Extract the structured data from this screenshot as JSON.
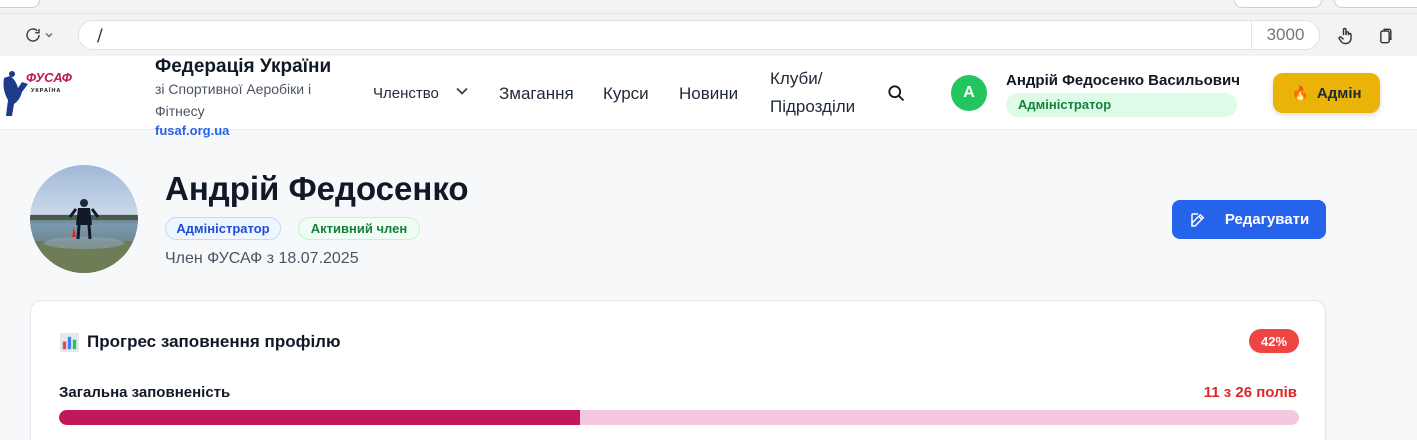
{
  "browser": {
    "url_path": "/",
    "port": "3000"
  },
  "header": {
    "logo_text": "ФУСАФ",
    "logo_sub": "УКРАЇНА",
    "brand_title": "Федерація України",
    "brand_subtitle": "зі Спортивної Аеробіки і Фітнесу",
    "brand_site": "fusaf.org.ua",
    "nav": {
      "membership": "Членство",
      "competitions": "Змагання",
      "courses": "Курси",
      "news": "Новини",
      "clubs_line1": "Клуби/",
      "clubs_line2": "Підрозділи"
    },
    "user": {
      "initial": "A",
      "name": "Андрій Федосенко Васильович",
      "role": "Адміністратор"
    },
    "admin_button": "Адмін"
  },
  "profile": {
    "name": "Андрій Федосенко",
    "badges": {
      "role": "Адміністратор",
      "status": "Активний член"
    },
    "member_since": "Член ФУСАФ з 18.07.2025",
    "edit_button": "Редагувати"
  },
  "progress_card": {
    "title": "Прогрес заповнення профілю",
    "percent_label": "42%",
    "overall_label": "Загальна заповненість",
    "fields_label": "11 з 26 полів",
    "fill_fraction": 0.42
  },
  "colors": {
    "primary_blue": "#2563eb",
    "admin_yellow": "#eab308",
    "success_green": "#22c55e",
    "progress_fill": "#c2185b",
    "progress_track": "#f4c9dd",
    "danger_red": "#ef4444"
  },
  "icons": {
    "reload": "reload-icon",
    "search": "search-icon",
    "edit": "edit-icon",
    "chart": "bar-chart-icon",
    "flame": "flame-icon"
  }
}
